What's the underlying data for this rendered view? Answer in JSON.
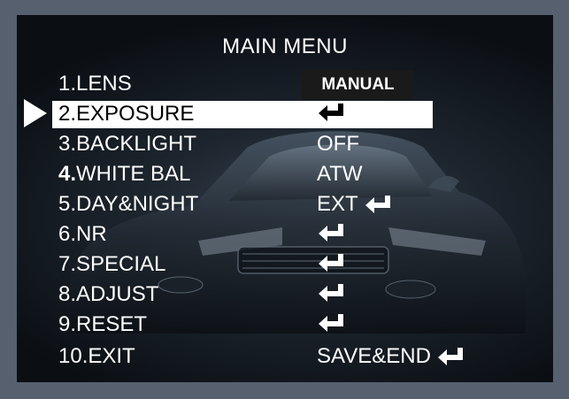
{
  "menu": {
    "title": "MAIN MENU",
    "items": [
      {
        "label": "1.LENS",
        "value": "MANUAL",
        "enter": false
      },
      {
        "label": "2.EXPOSURE",
        "value": "",
        "enter": true
      },
      {
        "label": "3.BACKLIGHT",
        "value": "OFF",
        "enter": false
      },
      {
        "label_num": "4.",
        "label_text": "WHITE BAL",
        "value": "ATW",
        "enter": false
      },
      {
        "label": "5.DAY&NIGHT",
        "value": "EXT",
        "enter": true
      },
      {
        "label": "6.NR",
        "value": "",
        "enter": true
      },
      {
        "label": "7.SPECIAL",
        "value": "",
        "enter": true
      },
      {
        "label": "8.ADJUST",
        "value": "",
        "enter": true
      },
      {
        "label": "9.RESET",
        "value": "",
        "enter": true
      },
      {
        "label": "10.EXIT",
        "value": "SAVE&END",
        "enter": true
      }
    ],
    "selected_index": 1
  },
  "icons": {
    "pointer": "triangle-right-icon",
    "enter": "enter-return-icon"
  },
  "colors": {
    "text": "#ffffff",
    "highlight": "#ffffff",
    "badge_bg": "#1a1a1a",
    "frame": "#56606f"
  }
}
